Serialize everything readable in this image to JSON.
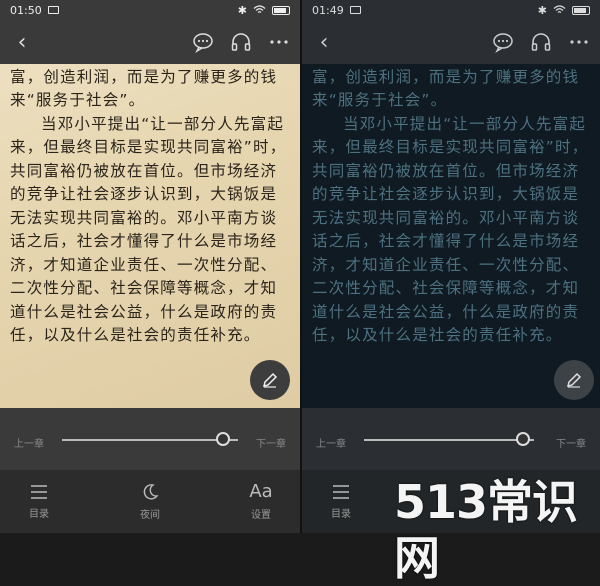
{
  "panels": [
    {
      "theme": "day",
      "status": {
        "time": "01:50"
      },
      "content": {
        "line0": "企业生存的目的，不是为了创造财富，创造利润，而是为了赚更多的钱来“服务于社会”。",
        "para": "当邓小平提出“让一部分人先富起来，但最终目标是实现共同富裕”时，共同富裕仍被放在首位。但市场经济的竞争让社会逐步认识到，大锅饭是无法实现共同富裕的。邓小平南方谈话之后，社会才懂得了什么是市场经济，才知道企业责任、一次性分配、二次性分配、社会保障等概念，才知道什么是社会公益，什么是政府的责任，以及什么是社会的责任补充。"
      },
      "slider": {
        "prev": "上一章",
        "next": "下一章",
        "progress": 0.87
      },
      "nav": {
        "toc": "目录",
        "night": "夜间",
        "settings": "设置"
      }
    },
    {
      "theme": "night",
      "status": {
        "time": "01:49"
      },
      "content": {
        "line0": "企业生存的目的，不是为了创造财富，创造利润，而是为了赚更多的钱来“服务于社会”。",
        "para": "当邓小平提出“让一部分人先富起来，但最终目标是实现共同富裕”时，共同富裕仍被放在首位。但市场经济的竞争让社会逐步认识到，大锅饭是无法实现共同富裕的。邓小平南方谈话之后，社会才懂得了什么是市场经济，才知道企业责任、一次性分配、二次性分配、社会保障等概念，才知道什么是社会公益，什么是政府的责任，以及什么是社会的责任补充。"
      },
      "slider": {
        "prev": "上一章",
        "next": "下一章",
        "progress": 0.87
      },
      "nav": {
        "toc": "目录"
      }
    }
  ],
  "watermark": "513常识网",
  "icons": {
    "back": "chevron-left-icon",
    "comment": "comment-bubble-icon",
    "listen": "headphones-icon",
    "more": "more-dots-icon",
    "edit": "pencil-icon",
    "toc": "list-icon",
    "night": "moon-icon",
    "settings": "font-aa-icon"
  }
}
